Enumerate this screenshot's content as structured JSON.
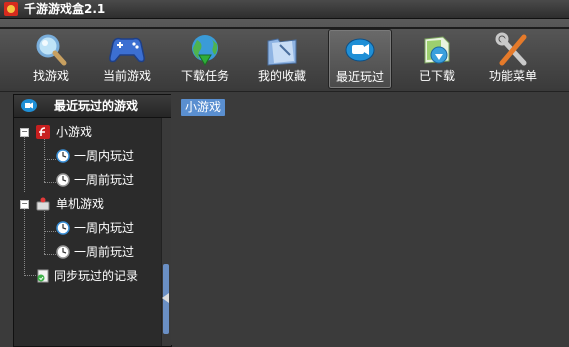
{
  "window": {
    "title": "千游游戏盒2.1"
  },
  "toolbar": {
    "items": [
      {
        "label": "找游戏",
        "icon": "magnifier-icon"
      },
      {
        "label": "当前游戏",
        "icon": "gamepad-icon"
      },
      {
        "label": "下载任务",
        "icon": "globe-download-icon"
      },
      {
        "label": "我的收藏",
        "icon": "folder-icon"
      },
      {
        "label": "最近玩过",
        "icon": "camera-icon",
        "active": true
      },
      {
        "label": "已下载",
        "icon": "downloaded-icon"
      },
      {
        "label": "功能菜单",
        "icon": "tools-icon"
      }
    ]
  },
  "sidebar": {
    "title": "最近玩过的游戏",
    "tree": [
      {
        "label": "小游戏",
        "icon": "flash-icon",
        "expanded": true,
        "children": [
          {
            "label": "一周内玩过",
            "icon": "clock-icon"
          },
          {
            "label": "一周前玩过",
            "icon": "clock-icon"
          }
        ]
      },
      {
        "label": "单机游戏",
        "icon": "pc-game-icon",
        "expanded": true,
        "children": [
          {
            "label": "一周内玩过",
            "icon": "clock-icon"
          },
          {
            "label": "一周前玩过",
            "icon": "clock-icon"
          }
        ]
      },
      {
        "label": "同步玩过的记录",
        "icon": "sync-icon"
      }
    ]
  },
  "main": {
    "tab": "小游戏"
  },
  "colors": {
    "accent": "#5a8fd0",
    "background": "#3b3b3b",
    "panel": "#2b2b2b"
  }
}
